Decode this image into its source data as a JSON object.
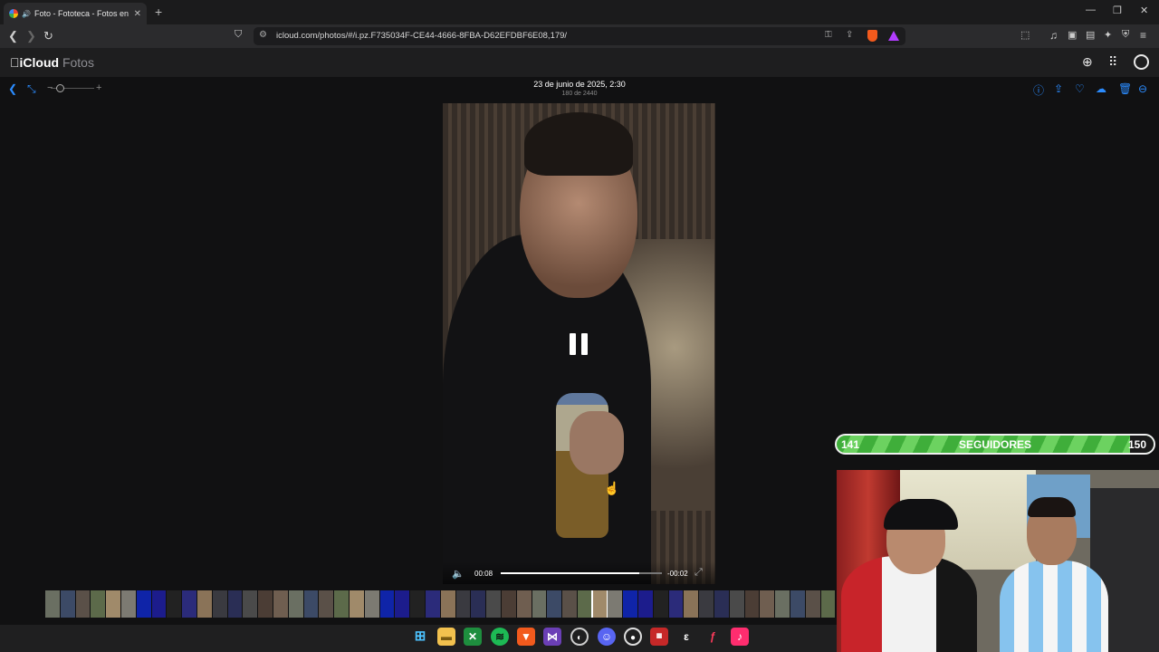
{
  "browser": {
    "tab_title": "Foto - Fototeca - Fotos en iCl",
    "new_tab": "+",
    "url": "icloud.com/photos/#/i.pz.F735034F-CE44-4666-8FBA-D62EFDBF6E08,179/",
    "window_controls": [
      "—",
      "❐",
      "✕"
    ]
  },
  "app": {
    "brand_name": "iCloud",
    "brand_section": "Fotos"
  },
  "viewer": {
    "date": "23 de junio de 2025, 2:30",
    "count": "180 de 2440",
    "zoom_minus": "−",
    "zoom_plus": "+",
    "zoom_level": 0.15
  },
  "player": {
    "elapsed": "00:08",
    "remaining": "-00:02",
    "progress": 0.86
  },
  "overlay": {
    "followers_current": "141",
    "followers_label": "SEGUIDORES",
    "followers_goal": "150"
  },
  "colors": {
    "accent": "#2b8cff",
    "background": "#111112",
    "follow_green": "#4cc04a"
  },
  "icons": {
    "toolbar_right": [
      "info-icon",
      "share-icon",
      "favorite-icon",
      "download-icon",
      "delete-icon",
      "more-icon"
    ],
    "taskbar": [
      "windows-start-icon",
      "file-explorer-icon",
      "xbox-icon",
      "spotify-icon",
      "brave-icon",
      "visual-studio-icon",
      "steam-icon",
      "discord-icon",
      "obs-icon",
      "wrapper-app-icon",
      "epic-games-icon",
      "tf-app-icon",
      "tiktok-icon"
    ]
  }
}
